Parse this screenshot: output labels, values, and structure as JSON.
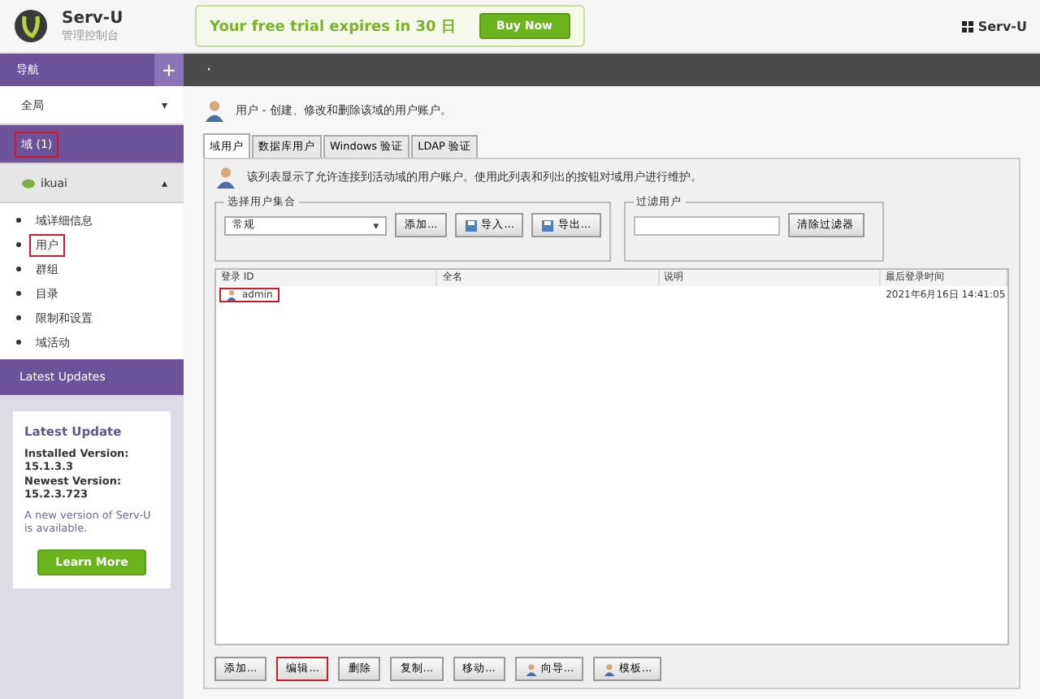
{
  "header": {
    "brand": "Serv-U",
    "subtitle": "管理控制台",
    "trial": "Your free trial expires in 30 日",
    "buy_button": "Buy Now",
    "app_menu": "Serv-U"
  },
  "nav": {
    "title": "导航",
    "add": "+",
    "sections": [
      {
        "label": "全局",
        "caret": "▾",
        "selected": false,
        "highlighted": false,
        "expanded": false
      },
      {
        "label": "域 (1)",
        "selected": true,
        "highlighted": true,
        "expanded": false
      },
      {
        "label": "ikuai",
        "caret": "▴",
        "selected": false,
        "highlighted": false,
        "expanded": true,
        "children": [
          {
            "label": "域详细信息",
            "highlighted": false
          },
          {
            "label": "用户",
            "highlighted": true
          },
          {
            "label": "群组",
            "highlighted": false
          },
          {
            "label": "目录",
            "highlighted": false
          },
          {
            "label": "限制和设置",
            "highlighted": false
          },
          {
            "label": "域活动",
            "highlighted": false
          }
        ]
      }
    ],
    "updates_title": "Latest Updates",
    "update_card": {
      "title": "Latest Update",
      "installed": "Installed Version: 15.1.3.3",
      "newest": "Newest Version: 15.2.3.723",
      "note": "A new version of Serv-U is available.",
      "button": "Learn More"
    }
  },
  "toolbar": {
    "dot": "·"
  },
  "page": {
    "description": "用户 - 创建、修改和删除该域的用户账户。",
    "tabs": [
      {
        "label": "域用户",
        "selected": true
      },
      {
        "label": "数据库用户",
        "selected": false
      },
      {
        "label": "Windows 验证",
        "selected": false
      },
      {
        "label": "LDAP 验证",
        "selected": false
      }
    ],
    "info": "该列表显示了允许连接到活动域的用户账户。使用此列表和列出的按钮对域用户进行维护。",
    "collection": {
      "legend": "选择用户集合",
      "value": "常规",
      "caret": "▾",
      "buttons": [
        {
          "label": "添加...",
          "kind": "plain"
        },
        {
          "label": "导入...",
          "kind": "disk"
        },
        {
          "label": "导出...",
          "kind": "disk"
        }
      ]
    },
    "filter": {
      "legend": "过滤用户",
      "button": "清除过滤器"
    },
    "table": {
      "columns": [
        "登录 ID",
        "全名",
        "说明",
        "最后登录时间"
      ],
      "rows": [
        {
          "login": "admin",
          "full_name": "",
          "description": "",
          "last_login": "2021年6月16日 14:41:05",
          "highlighted": true
        }
      ]
    },
    "actions": [
      {
        "label": "添加...",
        "kind": "plain",
        "highlighted": false
      },
      {
        "label": "编辑...",
        "kind": "plain",
        "highlighted": true
      },
      {
        "label": "删除",
        "kind": "plain",
        "highlighted": false
      },
      {
        "label": "复制...",
        "kind": "plain",
        "highlighted": false
      },
      {
        "label": "移动...",
        "kind": "plain",
        "highlighted": false
      },
      {
        "label": "向导...",
        "kind": "user",
        "highlighted": false
      },
      {
        "label": "模板...",
        "kind": "user",
        "highlighted": false
      }
    ]
  }
}
